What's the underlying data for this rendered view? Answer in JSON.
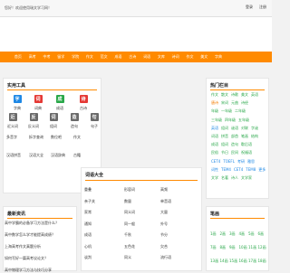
{
  "header": {
    "welcome_text": "您好！欢迎使用瑞文学习网！",
    "links": [
      "登录",
      "注册"
    ]
  },
  "nav": {
    "items": [
      "首页",
      "高考",
      "中考",
      "留学",
      "学院",
      "作文",
      "范文",
      "成语",
      "古诗",
      "词语",
      "文库",
      "诗词",
      "作文",
      "美文",
      "字典"
    ]
  },
  "tools": {
    "title": "实用工具",
    "row1": [
      {
        "icon": "dictionary-icon",
        "glyph": "字",
        "label": "字典",
        "color": "#1e88e5"
      },
      {
        "icon": "ci-dictionary-icon",
        "glyph": "词",
        "label": "词典",
        "color": "#e53935"
      },
      {
        "icon": "idiom-icon",
        "glyph": "成",
        "label": "成语",
        "color": "#2aa84a"
      },
      {
        "icon": "poetry-icon",
        "glyph": "诗",
        "label": "古诗",
        "color": "#e53935"
      }
    ],
    "row2": [
      {
        "icon": "synonym-icon",
        "glyph": "近",
        "label": "近义词",
        "color": "#6a6a6a"
      },
      {
        "icon": "antonym-icon",
        "glyph": "反",
        "label": "反义词",
        "color": "#6a6a6a"
      },
      {
        "icon": "word-icon",
        "glyph": "词",
        "label": "组词",
        "color": "#6a6a6a"
      },
      {
        "icon": "grammar-icon",
        "glyph": "造",
        "label": "造句",
        "color": "#6a6a6a"
      },
      {
        "icon": "sentence-icon",
        "glyph": "句",
        "label": "句子",
        "color": "#6a6a6a"
      }
    ],
    "row3": [
      "多音字",
      "拆字查询",
      "数位吧",
      "作文"
    ],
    "row4": [
      "汉语拼音",
      "汉语大全",
      "汉语辞典",
      "古籍"
    ]
  },
  "hot": {
    "title": "热门栏目",
    "rows": [
      [
        {
          "t": "作文",
          "c": "g"
        },
        {
          "t": "散文",
          "c": "g"
        },
        {
          "t": "诗歌",
          "c": "g"
        },
        {
          "t": "美文",
          "c": "g"
        },
        {
          "t": "英语",
          "c": "g"
        }
      ],
      [
        {
          "t": "唐诗",
          "c": "o"
        },
        {
          "t": "宋词",
          "c": "g"
        },
        {
          "t": "元曲",
          "c": "g"
        },
        {
          "t": "诗经",
          "c": "g"
        }
      ],
      [
        {
          "t": "年级",
          "c": "g"
        },
        {
          "t": "一年级",
          "c": "g"
        },
        {
          "t": "二年级",
          "c": "g"
        }
      ],
      [
        {
          "t": "三年级",
          "c": "g"
        },
        {
          "t": "四年级",
          "c": "g"
        },
        {
          "t": "五年级",
          "c": "g"
        }
      ],
      [
        {
          "t": "英语",
          "c": "b"
        },
        {
          "t": "组词",
          "c": "g"
        },
        {
          "t": "谜语",
          "c": "g"
        },
        {
          "t": "对联",
          "c": "g"
        },
        {
          "t": "字谜",
          "c": "g"
        }
      ],
      [
        {
          "t": "词语",
          "c": "g"
        },
        {
          "t": "拼音",
          "c": "g"
        },
        {
          "t": "部首",
          "c": "g"
        },
        {
          "t": "笔画",
          "c": "g"
        },
        {
          "t": "结构",
          "c": "g"
        }
      ],
      [
        {
          "t": "成语",
          "c": "g"
        },
        {
          "t": "组词",
          "c": "g"
        },
        {
          "t": "造句",
          "c": "g"
        },
        {
          "t": "歇后语",
          "c": "g"
        }
      ],
      [
        {
          "t": "民俗",
          "c": "g"
        },
        {
          "t": "节日",
          "c": "g"
        },
        {
          "t": "民间",
          "c": "g"
        },
        {
          "t": "祝福语",
          "c": "g"
        }
      ],
      [
        {
          "t": "CET4",
          "c": "b"
        },
        {
          "t": "TOEFL",
          "c": "b"
        },
        {
          "t": "考研",
          "c": "b"
        },
        {
          "t": "雅思",
          "c": "b"
        }
      ],
      [
        {
          "t": "词性",
          "c": "b"
        },
        {
          "t": "TEM4",
          "c": "b"
        },
        {
          "t": "CET4",
          "c": "b"
        },
        {
          "t": "TEM8",
          "c": "b"
        },
        {
          "t": "更多",
          "c": "b"
        }
      ],
      [
        {
          "t": "文学",
          "c": "g"
        },
        {
          "t": "名著",
          "c": "g"
        },
        {
          "t": "诗人",
          "c": "g"
        },
        {
          "t": "文学家",
          "c": "g"
        }
      ]
    ]
  },
  "words": {
    "title": "词语大全",
    "cols": [
      [
        "重叠",
        "亲子关",
        "家常",
        "通知",
        "成语",
        "心机",
        "谈判"
      ],
      [
        "形容词",
        "数量",
        "同义词",
        "同一般",
        "千秋",
        "五色花",
        "同义"
      ],
      [
        "高频",
        "单音语",
        "大量",
        "外号",
        "节分",
        "欠合",
        "流行语"
      ]
    ]
  },
  "news": {
    "title": "最新资讯",
    "items": [
      "高中学霸的必备学习方法是什么？",
      "高中数学怎么学才能提高成绩？",
      "上海高考作文真题分析",
      "如何写好一篇高考议论文？",
      "高中物理学习方法与技巧分享"
    ]
  },
  "bihua": {
    "title": "笔画",
    "rows": [
      [
        "1画",
        "2画",
        "3画",
        "4画",
        "5画",
        "6画"
      ],
      [
        "7画",
        "8画",
        "9画",
        "10画",
        "11画",
        "12画"
      ],
      [
        "13画",
        "14画",
        "15画",
        "16画",
        "17画",
        "18画"
      ]
    ]
  },
  "colors": {
    "accent": "#ff8a00",
    "hot_green": "#2aa84a",
    "link_blue": "#1e88e5"
  }
}
